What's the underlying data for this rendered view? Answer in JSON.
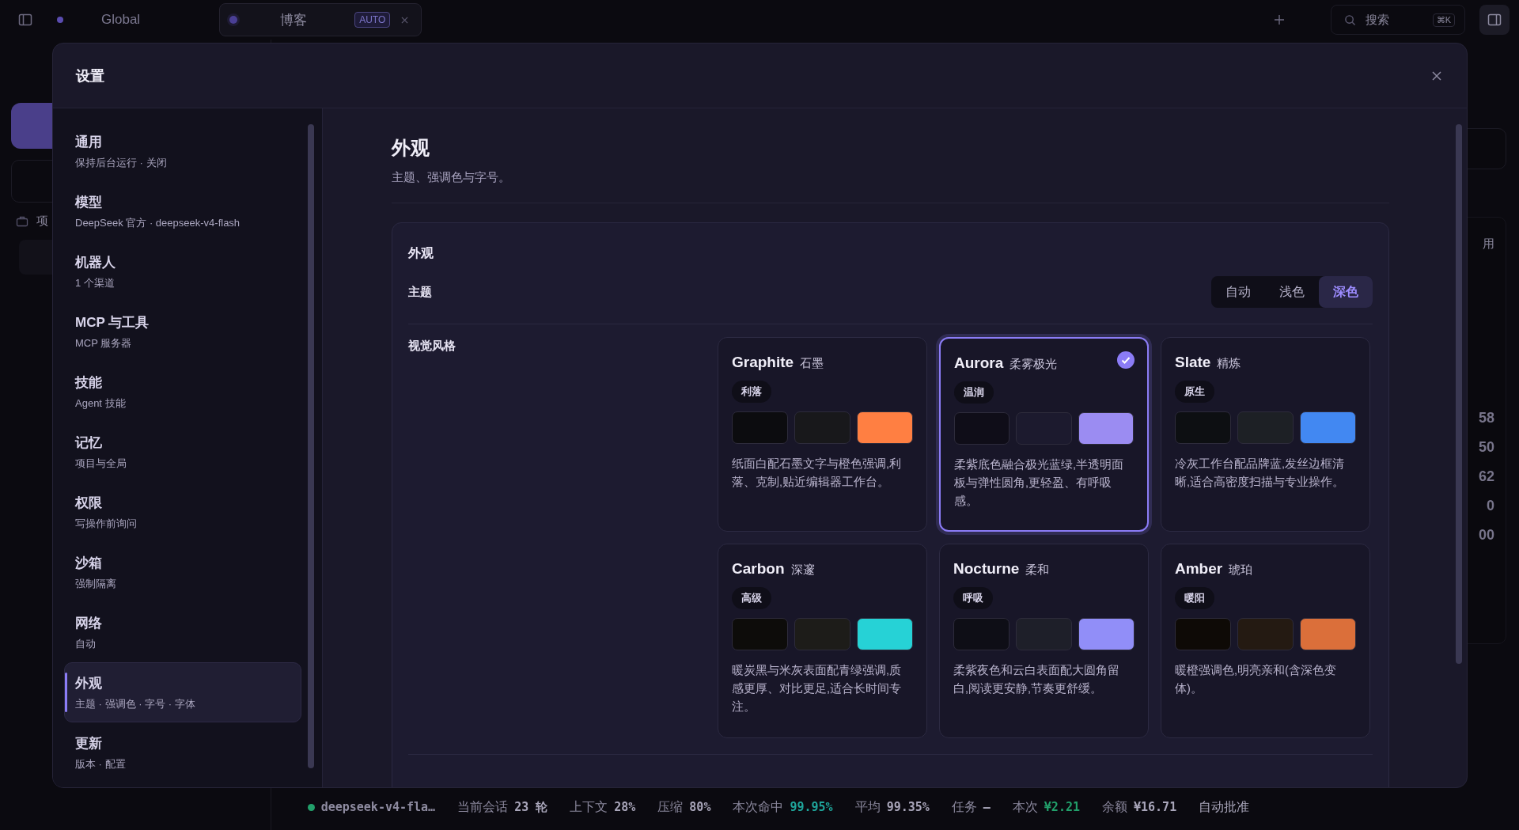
{
  "topbar": {
    "workspace": "Global",
    "tab": {
      "label": "博客",
      "badge": "AUTO"
    },
    "search": {
      "placeholder": "搜索",
      "shortcut": "⌘K"
    }
  },
  "background": {
    "sidebar_label": "项",
    "right_header": "用",
    "right_values": [
      "58",
      "50",
      "62",
      "0",
      "00"
    ]
  },
  "dialog": {
    "title": "设置",
    "nav": [
      {
        "label": "通用",
        "sub": "保持后台运行 · 关闭",
        "selected": false
      },
      {
        "label": "模型",
        "sub": "DeepSeek 官方 · deepseek-v4-flash",
        "selected": false
      },
      {
        "label": "机器人",
        "sub": "1 个渠道",
        "selected": false
      },
      {
        "label": "MCP 与工具",
        "sub": "MCP 服务器",
        "selected": false
      },
      {
        "label": "技能",
        "sub": "Agent 技能",
        "selected": false
      },
      {
        "label": "记忆",
        "sub": "项目与全局",
        "selected": false
      },
      {
        "label": "权限",
        "sub": "写操作前询问",
        "selected": false
      },
      {
        "label": "沙箱",
        "sub": "强制隔离",
        "selected": false
      },
      {
        "label": "网络",
        "sub": "自动",
        "selected": false
      },
      {
        "label": "外观",
        "sub": "主题 · 强调色 · 字号 · 字体",
        "selected": true
      },
      {
        "label": "更新",
        "sub": "版本 · 配置",
        "selected": false
      }
    ],
    "page": {
      "title": "外观",
      "subtitle": "主题、强调色与字号。"
    },
    "section": {
      "title": "外观",
      "theme": {
        "label": "主题",
        "options": [
          {
            "label": "自动",
            "selected": false
          },
          {
            "label": "浅色",
            "selected": false
          },
          {
            "label": "深色",
            "selected": true
          }
        ]
      },
      "style": {
        "label": "视觉风格",
        "cards": [
          {
            "name": "Graphite",
            "name_cn": "石墨",
            "tag": "利落",
            "selected": false,
            "swatches": [
              {
                "color": "#0c0c0f"
              },
              {
                "color": "#18181b"
              },
              {
                "color": "#ff7f42"
              }
            ],
            "description": "纸面白配石墨文字与橙色强调,利落、克制,贴近编辑器工作台。"
          },
          {
            "name": "Aurora",
            "name_cn": "柔雾极光",
            "tag": "温润",
            "selected": true,
            "swatches": [
              {
                "color": "#0f0d18"
              },
              {
                "color": "#1c1a2e"
              },
              {
                "color": "#9b8cf2"
              }
            ],
            "description": "柔紫底色融合极光蓝绿,半透明面板与弹性圆角,更轻盈、有呼吸感。"
          },
          {
            "name": "Slate",
            "name_cn": "精炼",
            "tag": "原生",
            "selected": false,
            "swatches": [
              {
                "color": "#0d0f12"
              },
              {
                "color": "#1d2025"
              },
              {
                "color": "#4288f2"
              }
            ],
            "description": "冷灰工作台配品牌蓝,发丝边框清晰,适合高密度扫描与专业操作。"
          },
          {
            "name": "Carbon",
            "name_cn": "深邃",
            "tag": "高级",
            "selected": false,
            "swatches": [
              {
                "color": "#0d0c0a"
              },
              {
                "color": "#1d1c19"
              },
              {
                "color": "#26d2d6"
              }
            ],
            "description": "暖炭黑与米灰表面配青绿强调,质感更厚、对比更足,适合长时间专注。"
          },
          {
            "name": "Nocturne",
            "name_cn": "柔和",
            "tag": "呼吸",
            "selected": false,
            "swatches": [
              {
                "color": "#0e0e16"
              },
              {
                "color": "#1e1f29"
              },
              {
                "color": "#918ef8"
              }
            ],
            "description": "柔紫夜色和云白表面配大圆角留白,阅读更安静,节奏更舒缓。"
          },
          {
            "name": "Amber",
            "name_cn": "琥珀",
            "tag": "暖阳",
            "selected": false,
            "swatches": [
              {
                "color": "#0e0a06"
              },
              {
                "color": "#241a12"
              },
              {
                "color": "#db6f3a"
              }
            ],
            "description": "暖橙强调色,明亮亲和(含深色变体)。"
          }
        ]
      }
    }
  },
  "status_bar": [
    {
      "kind": "model",
      "value": "deepseek-v4-fla…",
      "color": "#22a06b"
    },
    {
      "kind": "stat",
      "label": "当前会话",
      "value": "23 轮"
    },
    {
      "kind": "stat",
      "label": "上下文",
      "value": "28%"
    },
    {
      "kind": "stat",
      "label": "压缩",
      "value": "80%"
    },
    {
      "kind": "stat",
      "label": "本次命中",
      "value": "99.95%",
      "color": "#1fa59b"
    },
    {
      "kind": "stat",
      "label": "平均",
      "value": "99.35%"
    },
    {
      "kind": "stat",
      "label": "任务",
      "value": "–"
    },
    {
      "kind": "stat",
      "label": "本次",
      "value": "¥2.21",
      "color": "#22a06b"
    },
    {
      "kind": "stat",
      "label": "余额",
      "value": "¥16.71"
    },
    {
      "kind": "text",
      "label": "自动批准"
    }
  ]
}
